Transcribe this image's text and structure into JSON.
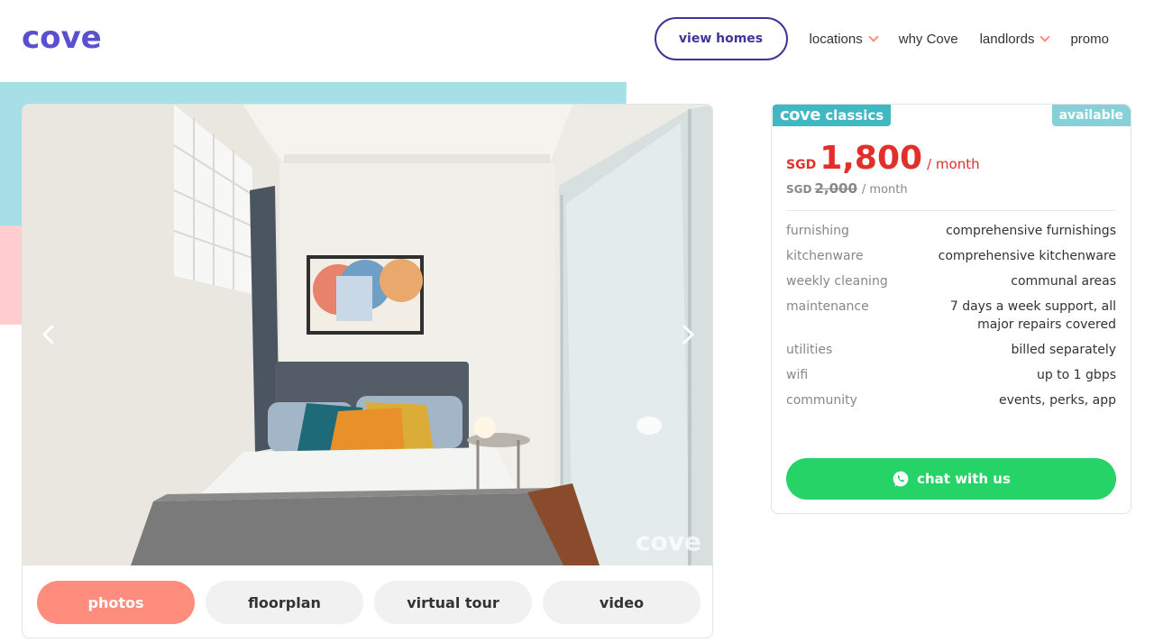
{
  "brand": {
    "logo": "cove"
  },
  "nav": {
    "view_homes": "view homes",
    "locations": "locations",
    "why_cove": "why Cove",
    "landlords": "landlords",
    "promo": "promo"
  },
  "gallery": {
    "watermark": "cove",
    "tabs": [
      "photos",
      "floorplan",
      "virtual tour",
      "video"
    ],
    "active_tab": "photos"
  },
  "listing": {
    "badge_brand": "cove",
    "badge_line": "classics",
    "availability": "available",
    "currency": "SGD",
    "price": "1,800",
    "per": "/ month",
    "old_currency": "SGD",
    "old_price": "2,000",
    "old_per": "/ month",
    "specs": [
      {
        "label": "furnishing",
        "value": "comprehensive furnishings"
      },
      {
        "label": "kitchenware",
        "value": "comprehensive kitchenware"
      },
      {
        "label": "weekly cleaning",
        "value": "communal areas"
      },
      {
        "label": "maintenance",
        "value": "7 days a week support, all major repairs covered"
      },
      {
        "label": "utilities",
        "value": "billed separately"
      },
      {
        "label": "wifi",
        "value": "up to 1 gbps"
      },
      {
        "label": "community",
        "value": "events, perks, app"
      }
    ],
    "chat_label": "chat with us"
  },
  "colors": {
    "brand": "#5a4fcf",
    "accent_coral": "#ff8d7e",
    "price_red": "#e1302b",
    "whatsapp_green": "#25d366",
    "teal": "#3fb8c4"
  }
}
